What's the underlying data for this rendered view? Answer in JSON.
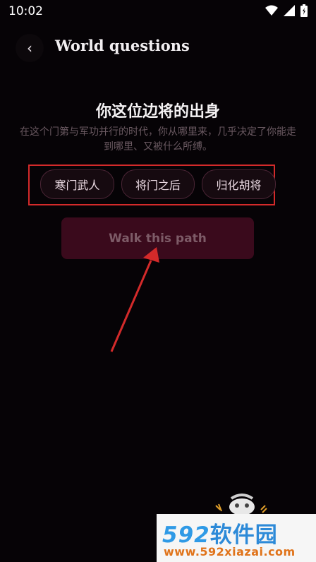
{
  "status_bar": {
    "time": "10:02"
  },
  "header": {
    "back_icon": "chevron-left-icon",
    "title": "World questions"
  },
  "question": {
    "title": "你这位边将的出身",
    "description": "在这个门第与军功并行的时代，你从哪里来，几乎决定了你能走到哪里、又被什么所缚。"
  },
  "options": [
    {
      "label": "寒门武人"
    },
    {
      "label": "将门之后"
    },
    {
      "label": "归化胡将"
    }
  ],
  "walk_button": {
    "label": "Walk this path"
  },
  "watermark": {
    "brand_num": "592",
    "brand_cn": "软件园",
    "url": "www.592xiazai.com"
  },
  "colors": {
    "background": "#060306",
    "annotation_red": "#d32a2a",
    "button_bg": "#3a0a1c",
    "watermark_blue": "#2f9ae6",
    "watermark_orange": "#e0731a"
  }
}
